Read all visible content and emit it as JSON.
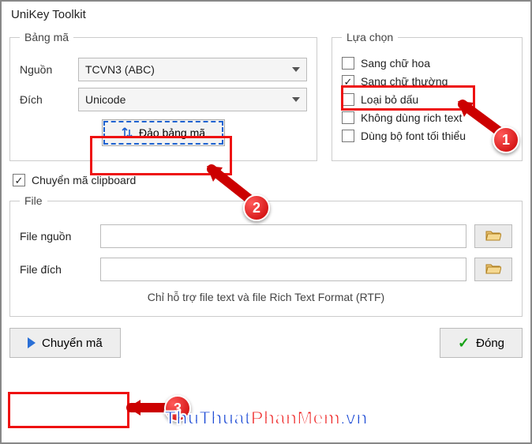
{
  "window": {
    "title": "UniKey Toolkit"
  },
  "bang_ma": {
    "legend": "Bảng mã",
    "nguon_label": "Nguồn",
    "nguon_value": "TCVN3 (ABC)",
    "dich_label": "Đích",
    "dich_value": "Unicode",
    "swap_label": "Đảo bảng mã"
  },
  "lua_chon": {
    "legend": "Lựa chọn",
    "items": [
      {
        "label": "Sang chữ hoa",
        "checked": false
      },
      {
        "label": "Sang chữ thường",
        "checked": true
      },
      {
        "label": "Loại bỏ dấu",
        "checked": false
      },
      {
        "label": "Không dùng rich text",
        "checked": false
      },
      {
        "label": "Dùng bộ font tối thiểu",
        "checked": false
      }
    ]
  },
  "clipboard": {
    "label": "Chuyển mã clipboard",
    "checked": true
  },
  "file": {
    "legend": "File",
    "nguon_label": "File nguồn",
    "dich_label": "File đích",
    "hint": "Chỉ hỗ trợ file text và file Rich Text Format (RTF)"
  },
  "buttons": {
    "convert": "Chuyển mã",
    "close": "Đóng"
  },
  "watermark": {
    "pre": "ThuThuat",
    "accent": "PhanMem",
    "suf": ".vn"
  },
  "annotations": [
    {
      "num": "1"
    },
    {
      "num": "2"
    },
    {
      "num": "3"
    }
  ]
}
